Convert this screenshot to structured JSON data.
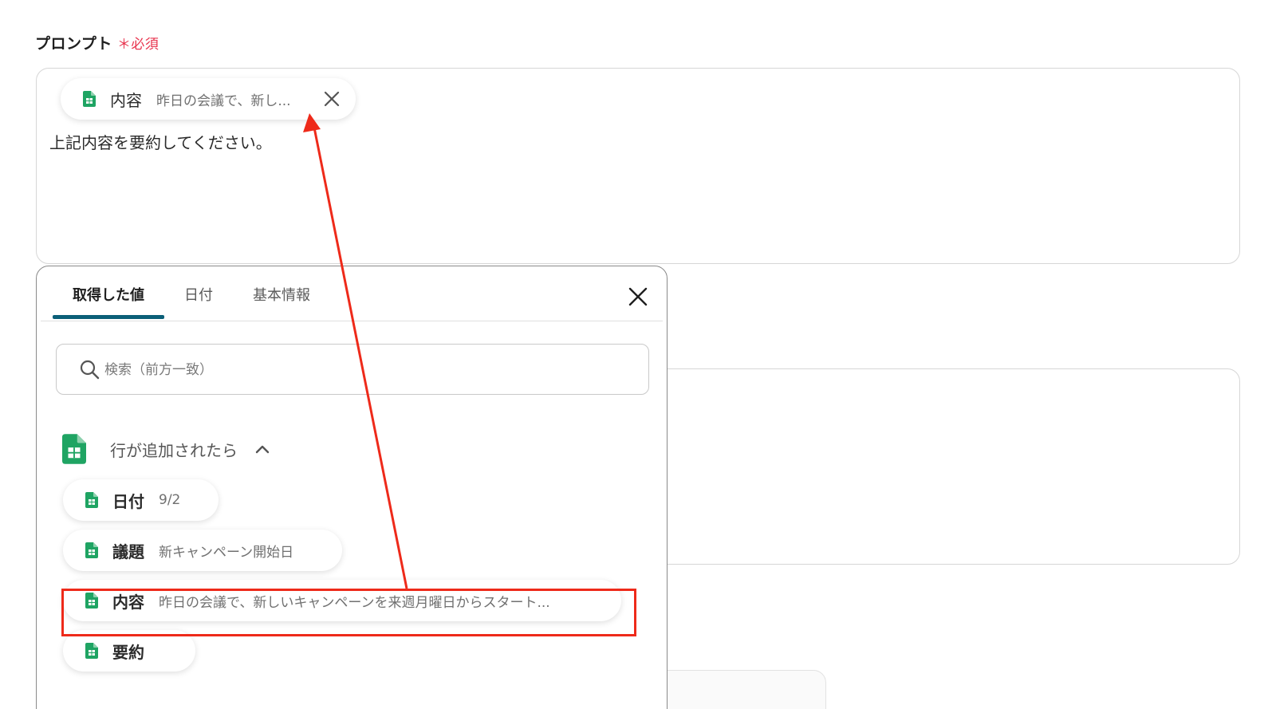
{
  "prompt": {
    "label": "プロンプト",
    "required_marker": "＊必須",
    "chip": {
      "key": "内容",
      "value": "昨日の会議で、新し..."
    },
    "text": "上記内容を要約してください。"
  },
  "panel": {
    "tabs": [
      {
        "label": "取得した値",
        "active": true
      },
      {
        "label": "日付",
        "active": false
      },
      {
        "label": "基本情報",
        "active": false
      }
    ],
    "search": {
      "placeholder": "検索（前方一致）",
      "value": ""
    },
    "group": {
      "title": "行が追加されたら",
      "icon": "google-sheets-icon",
      "expanded": true,
      "items": [
        {
          "key": "日付",
          "value": "9/2"
        },
        {
          "key": "議題",
          "value": "新キャンペーン開始日"
        },
        {
          "key": "内容",
          "value": "昨日の会議で、新しいキャンペーンを来週月曜日からスタート..."
        },
        {
          "key": "要約",
          "value": ""
        }
      ]
    }
  },
  "colors": {
    "accent": "#0b5f78",
    "sheets_green": "#1fa463",
    "required_red": "#e8344e",
    "annotation_red": "#ee2a1a"
  }
}
